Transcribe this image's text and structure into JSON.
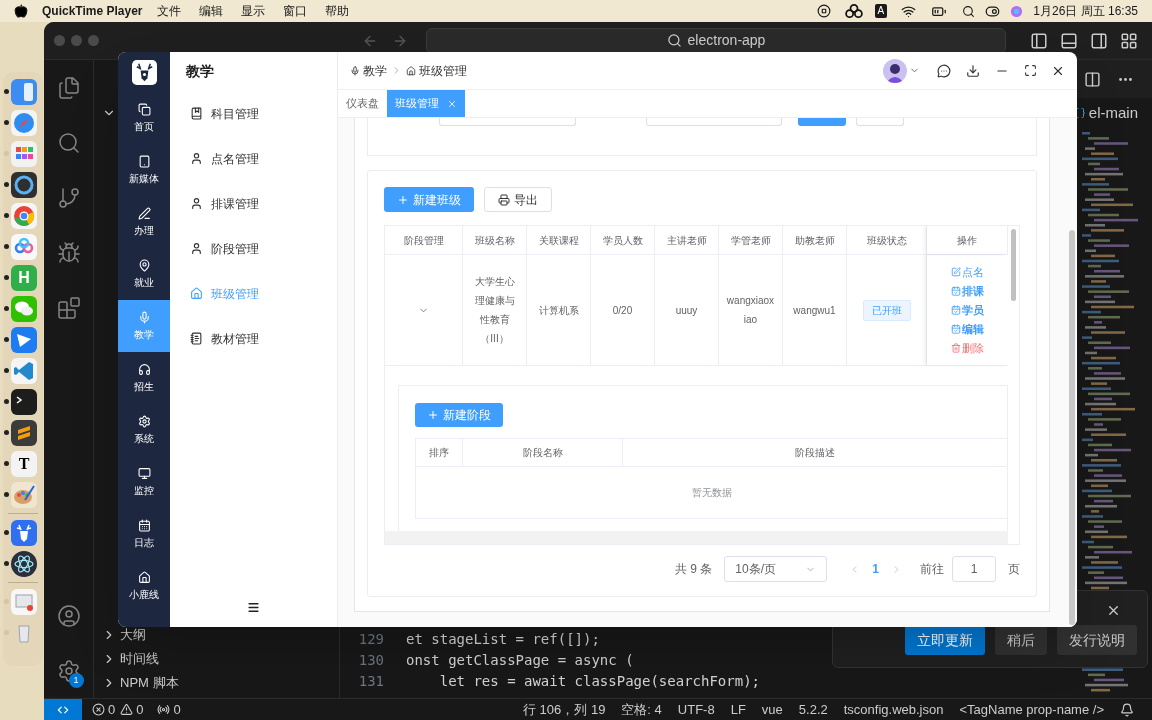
{
  "menubar": {
    "app": "QuickTime Player",
    "menus": [
      "文件",
      "编辑",
      "显示",
      "窗口",
      "帮助"
    ],
    "input_method": "A",
    "clock": "1月26日 周五 16:35"
  },
  "dock": [
    {
      "kind": "finder",
      "running": true
    },
    {
      "kind": "safari",
      "running": true
    },
    {
      "kind": "launchpad",
      "running": false
    },
    {
      "kind": "quicktime",
      "running": true
    },
    {
      "kind": "chrome",
      "running": true
    },
    {
      "kind": "cloud",
      "running": true
    },
    {
      "kind": "hbuilder",
      "running": true,
      "glyph": "H"
    },
    {
      "kind": "wechat",
      "running": true
    },
    {
      "kind": "feishu",
      "running": true
    },
    {
      "kind": "vscode",
      "running": true
    },
    {
      "kind": "terminal",
      "running": true
    },
    {
      "kind": "sublime",
      "running": true
    },
    {
      "kind": "typora",
      "running": true,
      "glyph": "T"
    },
    {
      "kind": "palette",
      "running": true
    },
    {
      "kind": "separator"
    },
    {
      "kind": "deer",
      "running": true
    },
    {
      "kind": "electron",
      "running": true
    },
    {
      "kind": "separator"
    },
    {
      "kind": "preview",
      "running": false
    },
    {
      "kind": "trash",
      "running": false
    }
  ],
  "vscode": {
    "title": "electron-app",
    "breadcrumb": "el-main",
    "settings_badge": "1",
    "sections": [
      "大纲",
      "时间线",
      "NPM 脚本"
    ],
    "code_lines": [
      {
        "number": "129",
        "text": "et stageList = ref([]);"
      },
      {
        "number": "130",
        "text": "onst getClassPage = async ("
      },
      {
        "number": "131",
        "text": "    let res = await classPage(searchForm);"
      }
    ],
    "notification": {
      "buttons": [
        {
          "label": "立即更新",
          "primary": true
        },
        {
          "label": "稍后",
          "primary": false
        },
        {
          "label": "发行说明",
          "primary": false
        }
      ]
    },
    "status_bar": {
      "errors": "0",
      "warnings": "0",
      "ports": "0",
      "items": [
        "行 106，列 19",
        "空格: 4",
        "UTF-8",
        "LF",
        "vue",
        "5.2.2",
        "tsconfig.web.json",
        "<TagName prop-name />"
      ]
    }
  },
  "app": {
    "nav": [
      {
        "label": "首页",
        "selected": false
      },
      {
        "label": "新媒体",
        "selected": false
      },
      {
        "label": "办理",
        "selected": false
      },
      {
        "label": "就业",
        "selected": false
      },
      {
        "label": "教学",
        "selected": true
      },
      {
        "label": "招生",
        "selected": false
      },
      {
        "label": "系统",
        "selected": false
      },
      {
        "label": "监控",
        "selected": false
      },
      {
        "label": "日志",
        "selected": false
      },
      {
        "label": "小鹿线",
        "selected": false
      }
    ],
    "submenu": {
      "title": "教学",
      "items": [
        {
          "label": "科目管理",
          "selected": false
        },
        {
          "label": "点名管理",
          "selected": false
        },
        {
          "label": "排课管理",
          "selected": false
        },
        {
          "label": "阶段管理",
          "selected": false
        },
        {
          "label": "班级管理",
          "selected": true
        },
        {
          "label": "教材管理",
          "selected": false
        }
      ]
    },
    "breadcrumb": [
      "教学",
      "班级管理"
    ],
    "tabs": [
      {
        "label": "仪表盘",
        "selected": false,
        "closable": false
      },
      {
        "label": "班级管理",
        "selected": true,
        "closable": true
      }
    ],
    "toolbar_buttons": [
      {
        "label": "新建班级",
        "primary": true
      },
      {
        "label": "导出",
        "primary": false
      }
    ],
    "table": {
      "columns": [
        "阶段管理",
        "班级名称",
        "关联课程",
        "学员人数",
        "主讲老师",
        "学管老师",
        "助教老师",
        "班级状态",
        "操作"
      ],
      "rows": [
        {
          "cells": [
            {
              "kind": "expand",
              "expanded": true
            },
            {
              "kind": "text",
              "text": "大学生心理健康与性教育（III）"
            },
            {
              "kind": "text",
              "text": "计算机系"
            },
            {
              "kind": "text",
              "text": "0/20"
            },
            {
              "kind": "text",
              "text": "uuuy"
            },
            {
              "kind": "text",
              "text": "wangxiaoxiao"
            },
            {
              "kind": "text",
              "text": "wangwu1"
            },
            {
              "kind": "tag",
              "text": "已开班"
            },
            {
              "kind": "actions",
              "actions": [
                {
                  "label": "点名",
                  "kind": "edit"
                },
                {
                  "label": "排课",
                  "kind": "normal"
                },
                {
                  "label": "学员",
                  "kind": "normal"
                },
                {
                  "label": "编辑",
                  "kind": "normal"
                },
                {
                  "label": "删除",
                  "kind": "danger"
                }
              ]
            }
          ],
          "stages": {
            "button": "新建阶段",
            "columns": [
              "排序",
              "阶段名称",
              "阶段描述"
            ],
            "empty_text": "暂无数据"
          }
        }
      ]
    },
    "pagination": {
      "total": "共 9 条",
      "page_size": "10条/页",
      "pages": [
        {
          "label": "1",
          "selected": true
        }
      ],
      "goto_label": "前往",
      "goto_value": "1",
      "goto_suffix": "页"
    }
  }
}
